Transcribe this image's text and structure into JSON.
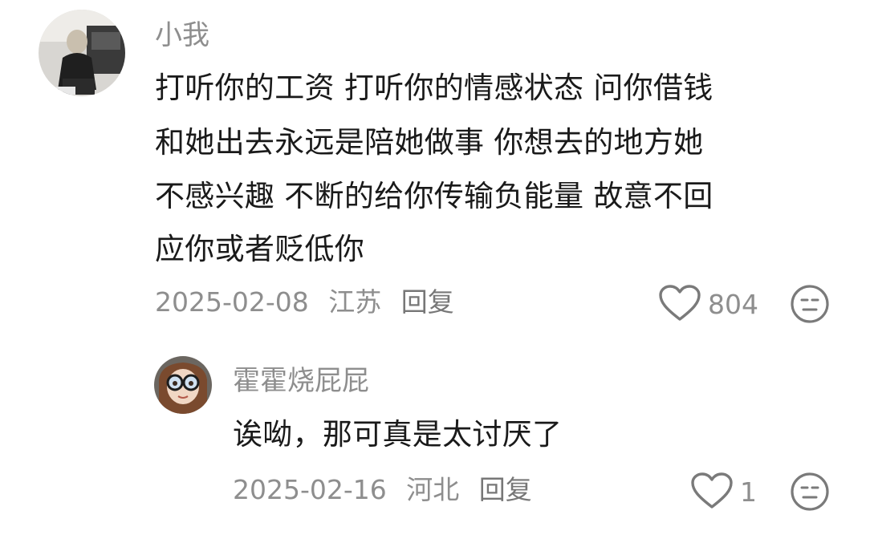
{
  "comments": [
    {
      "username": "小我",
      "lines": [
        "打听你的工资 打听你的情感状态 问你借钱",
        "和她出去永远是陪她做事 你想去的地方她",
        "不感兴趣 不断的给你传输负能量 故意不回",
        "应你或者贬低你"
      ],
      "date": "2025-02-08",
      "location": "江苏",
      "reply_label": "回复",
      "likes": "804",
      "icons": {
        "like": "heart-outline-icon",
        "dislike": "meh-face-icon"
      }
    }
  ],
  "replies": [
    {
      "username": "霍霍烧屁屁",
      "text": "诶呦，那可真是太讨厌了",
      "date": "2025-02-16",
      "location": "河北",
      "reply_label": "回复",
      "likes": "1",
      "icons": {
        "like": "heart-outline-icon",
        "dislike": "meh-face-icon"
      }
    }
  ],
  "colors": {
    "username": "#8e8e8e",
    "body_text": "#1a1a1a",
    "meta_text": "#8e8e8e",
    "icon_stroke": "#7a7a7a"
  }
}
